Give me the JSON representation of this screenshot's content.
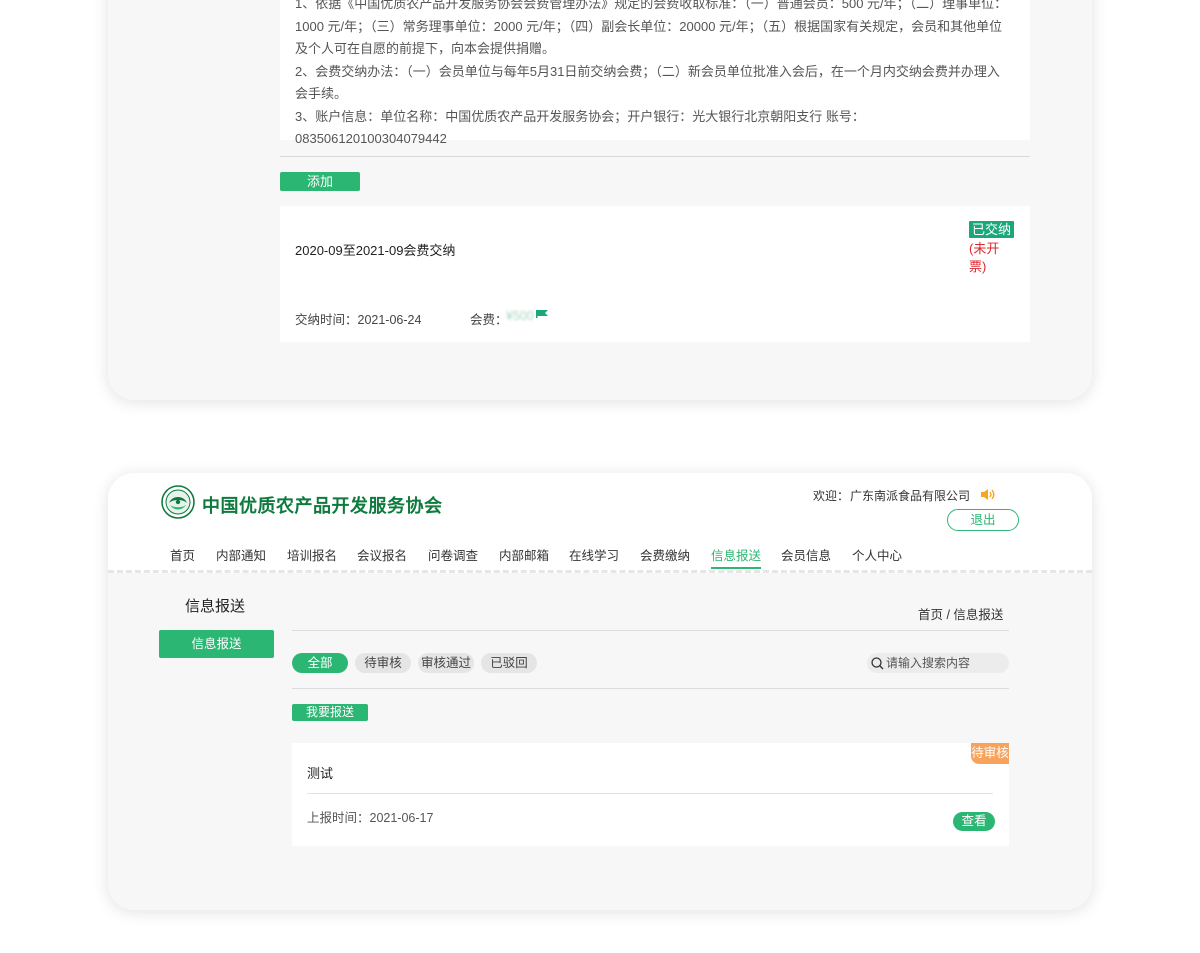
{
  "membership_card": {
    "info_lines": [
      "1、依据《中国优质农产品开发服务协会会费管理办法》规定的会费收取标准：（一）普通会员：500 元/年；（二）理事单位：",
      "1000 元/年；（三）常务理事单位：2000 元/年；（四）副会长单位：20000 元/年；（五）根据国家有关规定，会员和其他单位",
      "及个人可在自愿的前提下，向本会提供捐赠。",
      "2、会费交纳办法：（一）会员单位与每年5月31日前交纳会费；（二）新会员单位批准入会后，在一个月内交纳会费并办理入",
      "会手续。",
      "3、账户信息：单位名称：中国优质农产品开发服务协会；开户银行：光大银行北京朝阳支行 账号：083506120100304079442"
    ],
    "add_label": "添加",
    "fee_record": {
      "title": "2020-09至2021-09会费交纳",
      "status_paid": "已交纳",
      "status_invoice": "(未开票)",
      "pay_time": "交纳时间：2021-06-24",
      "fee_label": "会费：",
      "fee_value": "¥500"
    }
  },
  "portal": {
    "org_name": "中国优质农产品开发服务协会",
    "welcome": "欢迎：",
    "company": "广东南派食品有限公司",
    "logout": "退出",
    "nav": [
      {
        "label": "首页"
      },
      {
        "label": "内部通知"
      },
      {
        "label": "培训报名"
      },
      {
        "label": "会议报名"
      },
      {
        "label": "问卷调查"
      },
      {
        "label": "内部邮箱"
      },
      {
        "label": "在线学习"
      },
      {
        "label": "会费缴纳"
      },
      {
        "label": "信息报送"
      },
      {
        "label": "会员信息"
      },
      {
        "label": "个人中心"
      }
    ],
    "active_nav": "信息报送",
    "sidebar_title": "信息报送",
    "sidebar_button": "信息报送",
    "breadcrumb": "首页  /  信息报送",
    "filters": [
      "全部",
      "待审核",
      "审核通过",
      "已驳回"
    ],
    "search_placeholder": "请输入搜索内容",
    "report_button": "我要报送",
    "report": {
      "title": "测试",
      "status": "待审核",
      "time": "上报时间：2021-06-17",
      "view": "查看"
    }
  },
  "colors": {
    "brand_green": "#2bb673",
    "org_name_green": "#0e7a3e",
    "paid_badge": "#1aa87a",
    "invoice_red": "#e0262d",
    "pending_orange": "#f7a35c"
  }
}
